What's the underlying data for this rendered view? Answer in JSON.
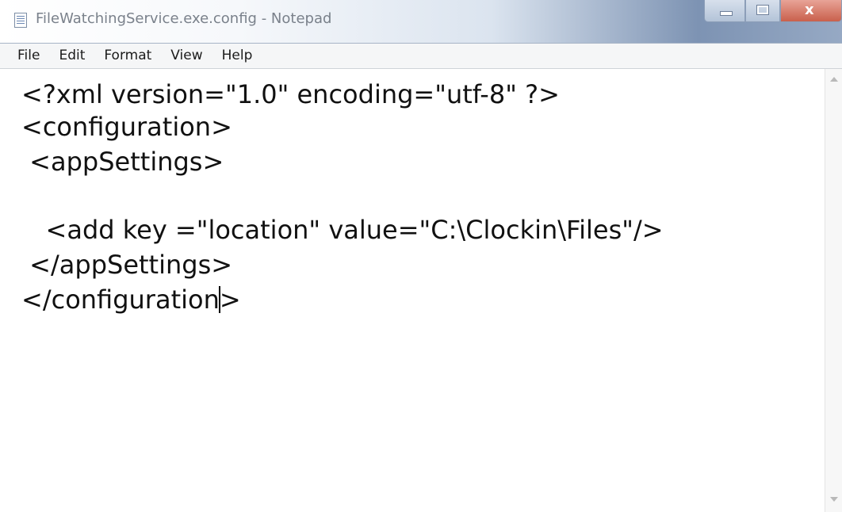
{
  "window": {
    "title": "FileWatchingService.exe.config - Notepad",
    "app_icon": "notepad-icon",
    "caption_buttons": {
      "minimize_icon": "minimize-icon",
      "maximize_icon": "maximize-icon",
      "close_icon": "close-icon",
      "close_glyph": "x"
    }
  },
  "menu": {
    "items": [
      {
        "label": "File"
      },
      {
        "label": "Edit"
      },
      {
        "label": "Format"
      },
      {
        "label": "View"
      },
      {
        "label": "Help"
      }
    ]
  },
  "editor": {
    "lines": [
      "<?xml version=\"1.0\" encoding=\"utf-8\" ?>",
      "<configuration>",
      " <appSettings>",
      "",
      "   <add key =\"location\" value=\"C:\\Clockin\\Files\"/>",
      " </appSettings>",
      "</configuration"
    ],
    "last_line_after_caret": ">"
  },
  "scrollbar": {
    "up_icon": "scroll-up-arrow-icon",
    "down_icon": "scroll-down-arrow-icon"
  },
  "colors": {
    "titlebar_accent": "#7d93b3",
    "close_button": "#c9604c",
    "text": "#111111"
  }
}
